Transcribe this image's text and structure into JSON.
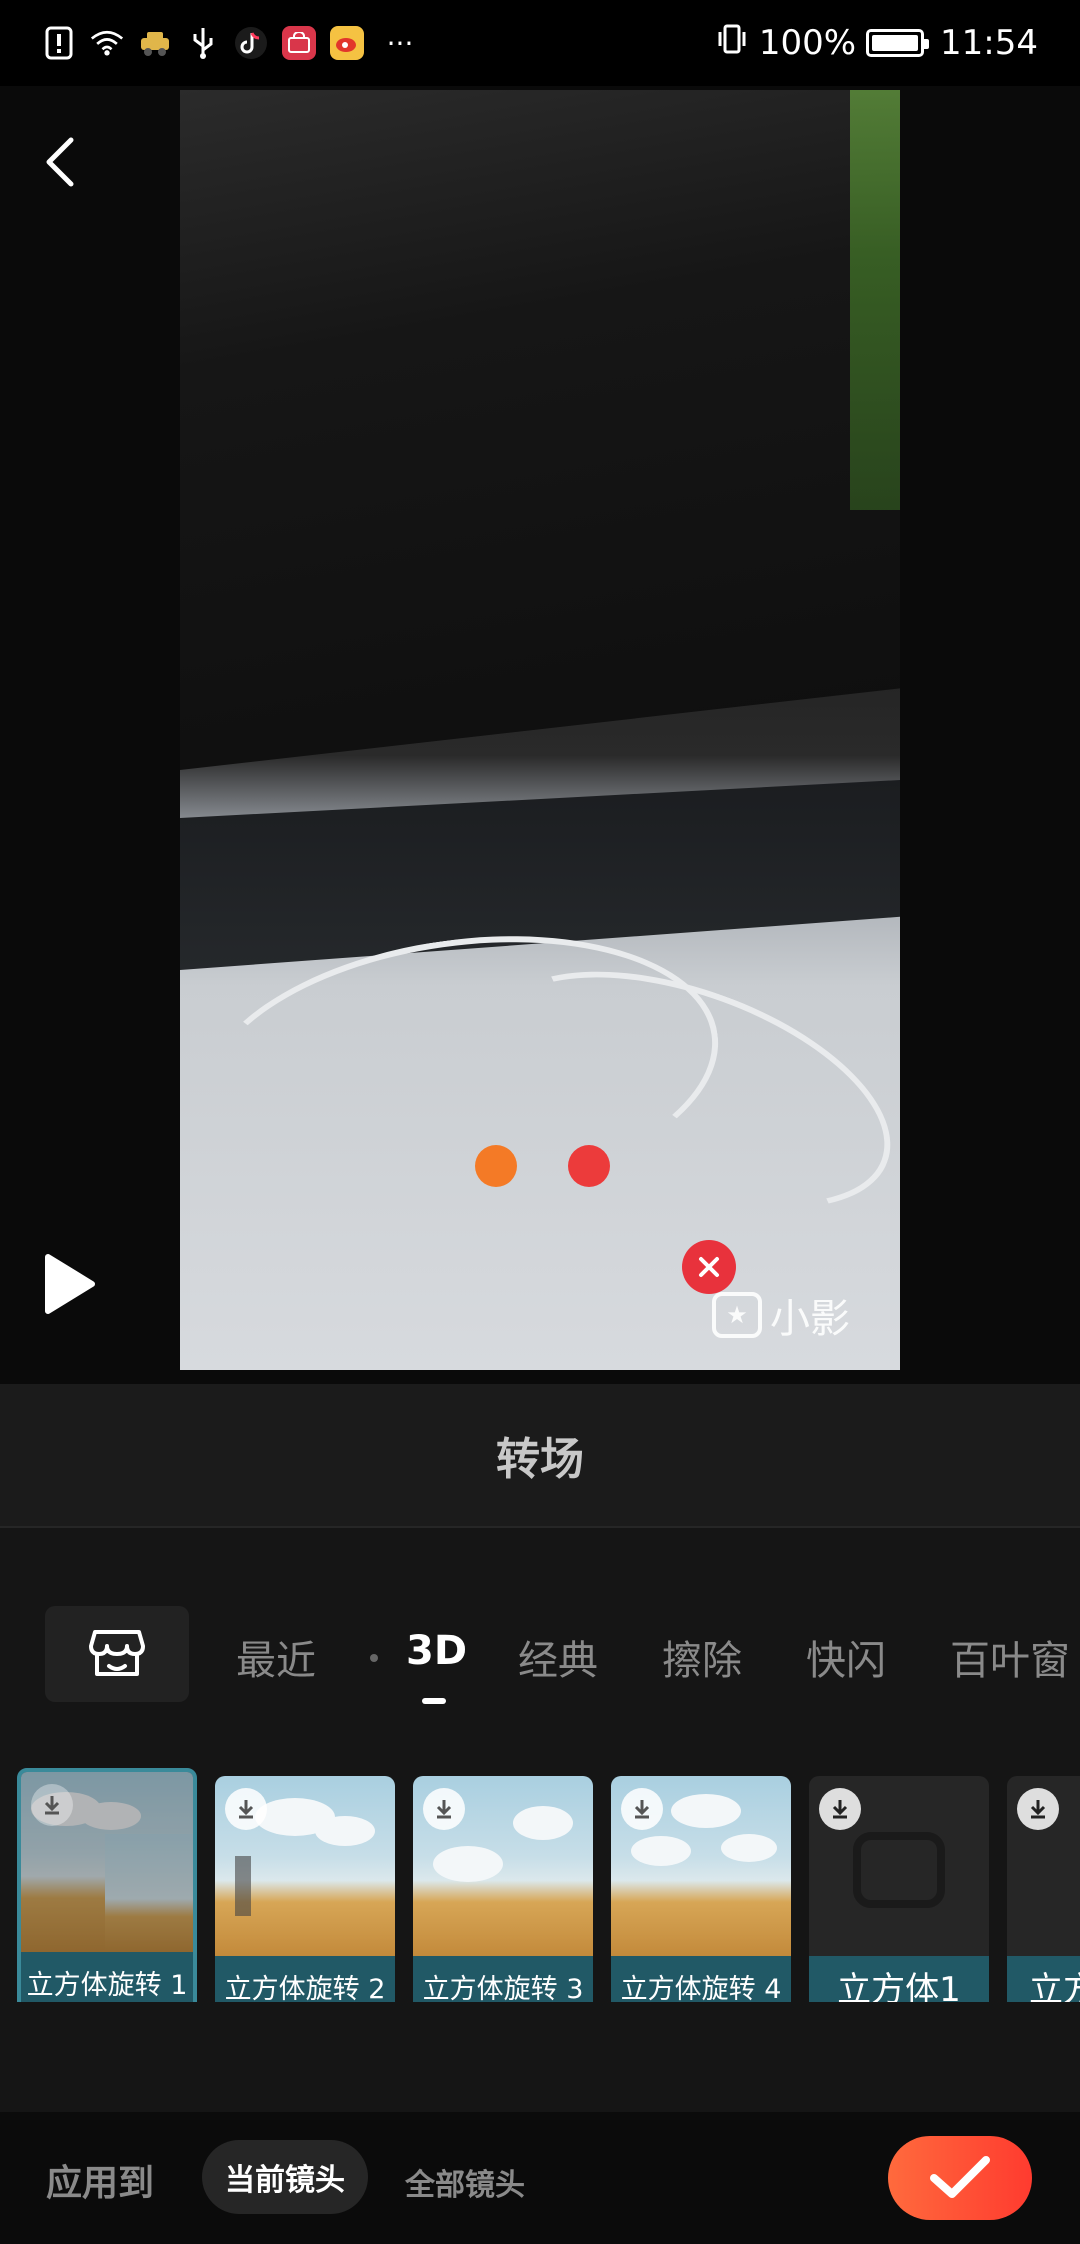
{
  "status_bar": {
    "battery_percent": "100%",
    "time": "11:54",
    "more_indicator": "···",
    "notification_icons": [
      "alert-icon",
      "wifi-icon",
      "taxi-app-icon",
      "usb-icon",
      "tiktok-icon",
      "shopping-app-icon",
      "weibo-icon"
    ]
  },
  "preview": {
    "watermark_text": "小影"
  },
  "panel": {
    "title": "转场",
    "tabs": [
      {
        "label": "最近"
      },
      {
        "label": "3D"
      },
      {
        "label": "经典"
      },
      {
        "label": "擦除"
      },
      {
        "label": "快闪"
      },
      {
        "label": "百叶窗"
      }
    ],
    "active_tab": "3D",
    "effects": [
      {
        "label": "立方体旋转 1",
        "selected": true
      },
      {
        "label": "立方体旋转 2",
        "selected": false
      },
      {
        "label": "立方体旋转 3",
        "selected": false
      },
      {
        "label": "立方体旋转 4",
        "selected": false
      },
      {
        "label": "立方体1",
        "selected": false
      },
      {
        "label": "立方",
        "selected": false
      }
    ]
  },
  "bottom_bar": {
    "apply_label": "应用到",
    "current_scope": "当前镜头",
    "all_scope": "全部镜头"
  },
  "colors": {
    "accent": "#ff4a33",
    "label_bg": "#215966",
    "remove_red": "#e8323c"
  }
}
